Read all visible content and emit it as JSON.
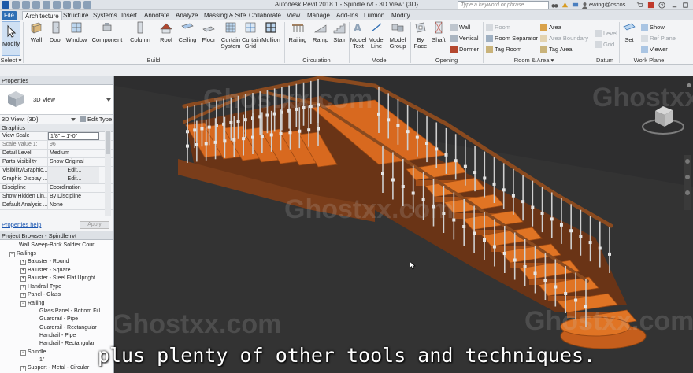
{
  "window": {
    "title": "Autodesk Revit 2018.1 -   Spindle.rvt - 3D View: {3D}",
    "search_placeholder": "Type a keyword or phrase",
    "user": "ewing@cscos..."
  },
  "tabs": [
    "File",
    "Architecture",
    "Structure",
    "Systems",
    "Insert",
    "Annotate",
    "Analyze",
    "Massing & Site",
    "Collaborate",
    "View",
    "Manage",
    "Add-Ins",
    "Lumion",
    "Modify"
  ],
  "active_tab": "Architecture",
  "ribbon": {
    "select": {
      "modify": "Modify",
      "label": "Select ▾"
    },
    "build": {
      "buttons": [
        "Wall",
        "Door",
        "Window",
        "Component",
        "Column",
        "Roof",
        "Ceiling",
        "Floor",
        "Curtain System",
        "Curtain Grid",
        "Mullion"
      ],
      "label": "Build"
    },
    "circulation": {
      "buttons": [
        "Railing",
        "Ramp",
        "Stair"
      ],
      "label": "Circulation"
    },
    "model": {
      "buttons": [
        "Model Text",
        "Model Line",
        "Model Group"
      ],
      "label": "Model"
    },
    "opening": {
      "buttons": [
        "By Face",
        "Shaft"
      ],
      "small": [
        "Wall",
        "Vertical",
        "Dormer"
      ],
      "label": "Opening"
    },
    "room_area": {
      "small": [
        "Room",
        "Room Separator",
        "Tag Room",
        "Area",
        "Area Boundary",
        "Tag Area"
      ],
      "label": "Room & Area ▾"
    },
    "datum": {
      "small": [
        "Level",
        "Grid"
      ],
      "label": "Datum"
    },
    "work_plane": {
      "set": "Set",
      "small": [
        "Show",
        "Ref Plane",
        "Viewer"
      ],
      "label": "Work Plane"
    }
  },
  "properties": {
    "title": "Properties",
    "type_name": "3D View",
    "view_selector": "3D View: {3D}",
    "edit_type": "Edit Type",
    "category": "Graphics",
    "rows": [
      {
        "k": "View Scale",
        "v": "1/8\" = 1'-0\""
      },
      {
        "k": "Scale Value    1:",
        "v": "96"
      },
      {
        "k": "Detail Level",
        "v": "Medium"
      },
      {
        "k": "Parts Visibility",
        "v": "Show Original"
      },
      {
        "k": "Visibility/Graphic...",
        "v": "Edit..."
      },
      {
        "k": "Graphic Display ...",
        "v": "Edit..."
      },
      {
        "k": "Discipline",
        "v": "Coordination"
      },
      {
        "k": "Show Hidden Lin...",
        "v": "By Discipline"
      },
      {
        "k": "Default Analysis ...",
        "v": "None"
      }
    ],
    "help": "Properties help",
    "apply": "Apply"
  },
  "browser": {
    "title": "Project Browser - Spindle.rvt",
    "items": [
      "Wall Sweep-Brick Soldier Cour",
      "Railings",
      "Baluster - Round",
      "Baluster - Square",
      "Baluster - Steel Flat Upright",
      "Handrail Type",
      "Panel - Glass",
      "Railing",
      "Glass Panel - Bottom Fill",
      "Guardrail - Pipe",
      "Guardrail - Rectangular",
      "Handrail - Pipe",
      "Handrail - Rectangular",
      "Spindle",
      "1\"",
      "Support - Metal - Circular"
    ]
  },
  "watermark": "Ghostxx.com",
  "subtitle": "plus plenty of other tools and techniques."
}
